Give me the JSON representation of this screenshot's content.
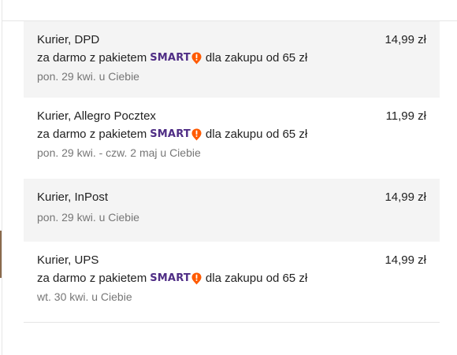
{
  "smart": {
    "brand_text": "SMART",
    "brand_color": "#4f2d85",
    "badge_color": "#ff5a00",
    "icon": "smart-exclamation-badge"
  },
  "options": [
    {
      "carrier": "Kurier, DPD",
      "price": "14,99 zł",
      "promo_prefix": "za darmo z pakietem",
      "promo_suffix": "dla zakupu od 65 zł",
      "delivery": "pon. 29 kwi. u Ciebie"
    },
    {
      "carrier": "Kurier, Allegro Pocztex",
      "price": "11,99 zł",
      "promo_prefix": "za darmo z pakietem",
      "promo_suffix": "dla zakupu od 65 zł",
      "delivery": "pon. 29 kwi. - czw. 2 maj u Ciebie"
    },
    {
      "carrier": "Kurier, InPost",
      "price": "14,99 zł",
      "delivery": "pon. 29 kwi. u Ciebie"
    },
    {
      "carrier": "Kurier, UPS",
      "price": "14,99 zł",
      "promo_prefix": "za darmo z pakietem",
      "promo_suffix": "dla zakupu od 65 zł",
      "delivery": "wt. 30 kwi. u Ciebie"
    }
  ]
}
